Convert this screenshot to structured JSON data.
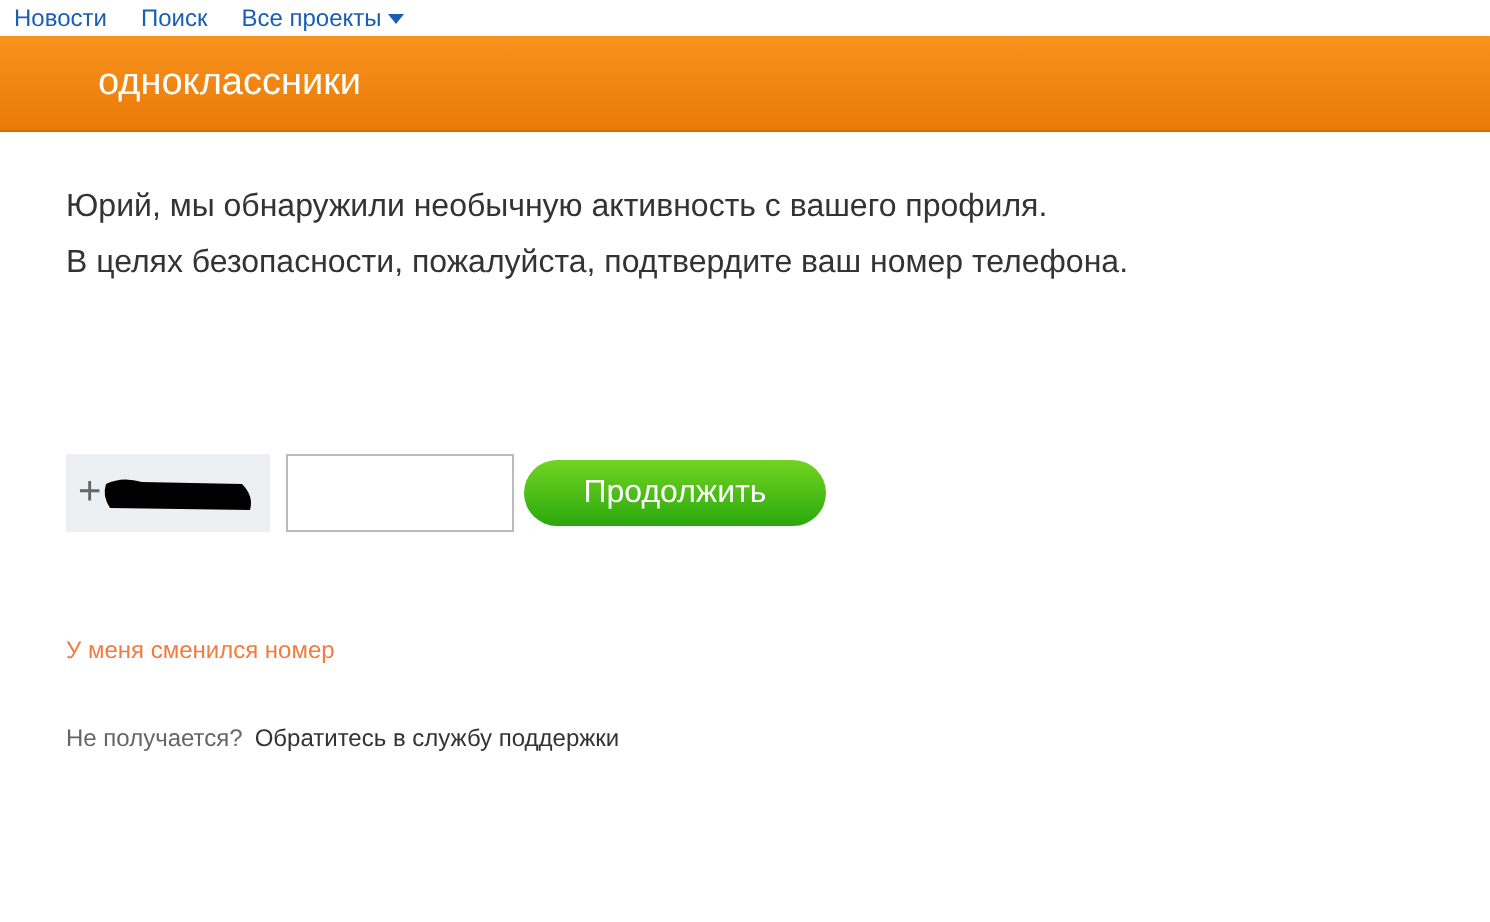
{
  "top_nav": {
    "items": [
      {
        "label": "Новости",
        "dropdown": false
      },
      {
        "label": "Поиск",
        "dropdown": false
      },
      {
        "label": "Все проекты",
        "dropdown": true
      }
    ]
  },
  "header": {
    "logo": "одноклассники"
  },
  "message": [
    "Юрий, мы обнаружили необычную активность с вашего профиля.",
    "В целях безопасности, пожалуйста, подтвердите ваш номер телефона."
  ],
  "phone": {
    "prefix": "+",
    "redacted": true
  },
  "continue_button": "Продолжить",
  "changed_number_link": "У меня сменился номер",
  "help": {
    "text": "Не получается?",
    "link": "Обратитесь в службу поддержки"
  }
}
